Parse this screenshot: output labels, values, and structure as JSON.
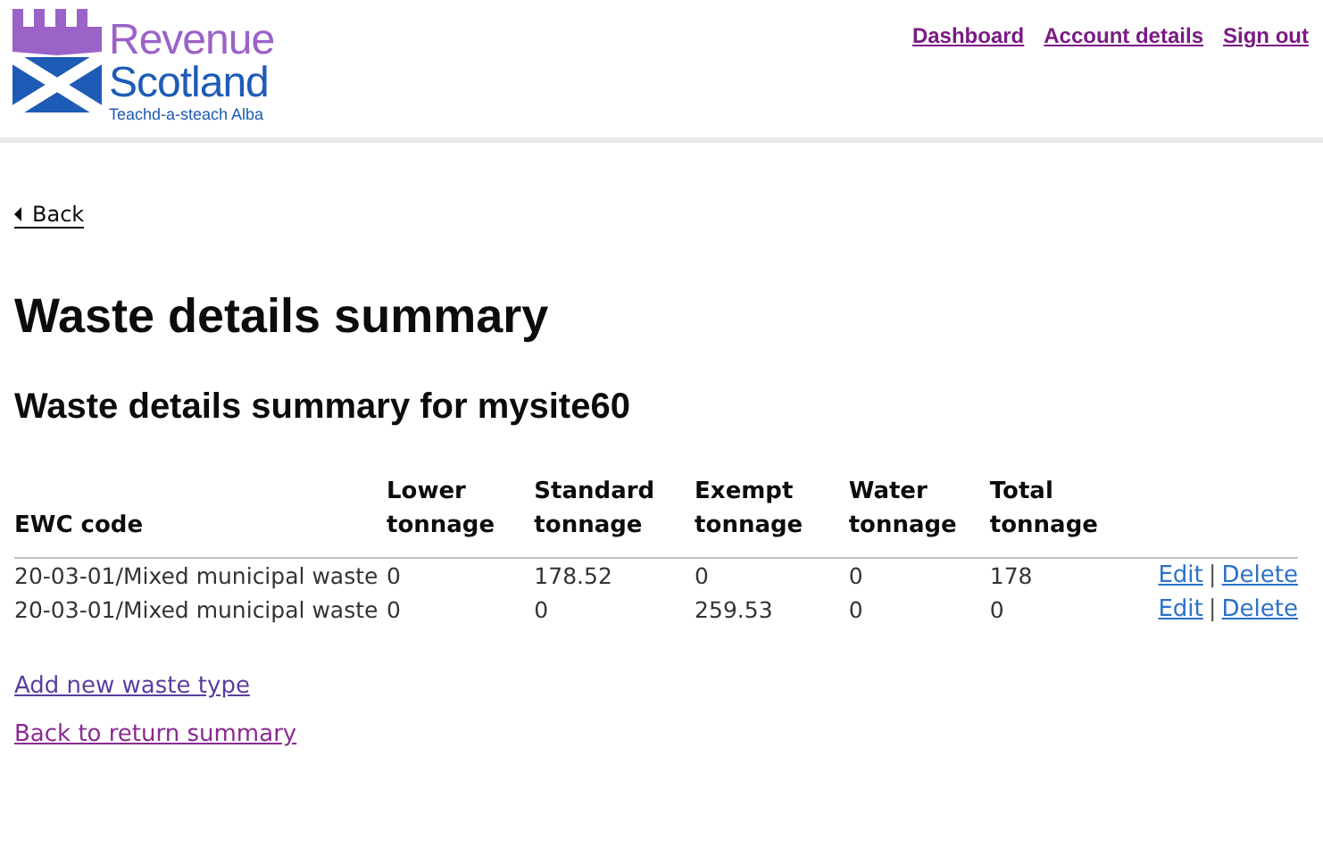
{
  "logo": {
    "line_1": "Revenue",
    "line_2": "Scotland",
    "tagline": "Teachd-a-steach Alba"
  },
  "nav": [
    "Dashboard",
    "Account details",
    "Sign out"
  ],
  "back_link": "Back",
  "title": "Waste details summary",
  "subtitle": "Waste details summary for mysite60",
  "table": {
    "columns": [
      "EWC code",
      "Lower tonnage",
      "Standard tonnage",
      "Exempt tonnage",
      "Water tonnage",
      "Total tonnage"
    ],
    "rows": [
      {
        "cells": [
          "20-03-01/Mixed municipal waste",
          "0",
          "178.52",
          "0",
          "0",
          "178"
        ],
        "actions": [
          "Edit",
          "Delete"
        ],
        "separator": "|"
      },
      {
        "cells": [
          "20-03-01/Mixed municipal waste",
          "0",
          "0",
          "259.53",
          "0",
          "0"
        ],
        "actions": [
          "Edit",
          "Delete"
        ],
        "separator": "|"
      }
    ]
  },
  "links": [
    "Add new waste type",
    "Back to return summary"
  ]
}
